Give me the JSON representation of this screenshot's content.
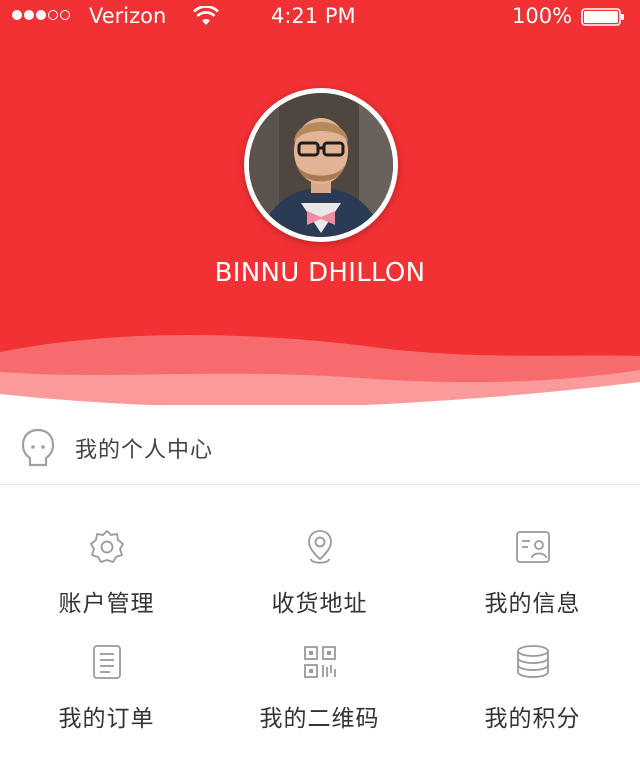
{
  "status_bar": {
    "carrier": "Verizon",
    "time": "4:21 PM",
    "battery": "100%",
    "signal_bars_filled": 3,
    "signal_bars_total": 5
  },
  "profile": {
    "name": "BINNU DHILLON"
  },
  "personal_center": {
    "label": "我的个人中心",
    "icon": "face-icon"
  },
  "menu": [
    {
      "label": "账户管理",
      "icon": "gear-icon"
    },
    {
      "label": "收货地址",
      "icon": "location-pin-icon"
    },
    {
      "label": "我的信息",
      "icon": "profile-card-icon"
    },
    {
      "label": "我的订单",
      "icon": "document-list-icon"
    },
    {
      "label": "我的二维码",
      "icon": "qr-code-icon"
    },
    {
      "label": "我的积分",
      "icon": "coin-stack-icon"
    }
  ],
  "colors": {
    "header_red": "#f23134",
    "icon_gray": "#9a9a9a"
  }
}
